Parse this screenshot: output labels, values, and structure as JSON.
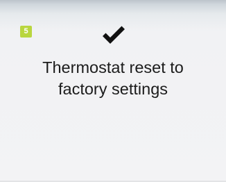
{
  "screen": {
    "step_number": "5",
    "step_badge_color": "#b9d63f",
    "status_icon": "checkmark-icon",
    "message_lines": [
      "Thermostat reset to",
      "factory settings"
    ]
  }
}
